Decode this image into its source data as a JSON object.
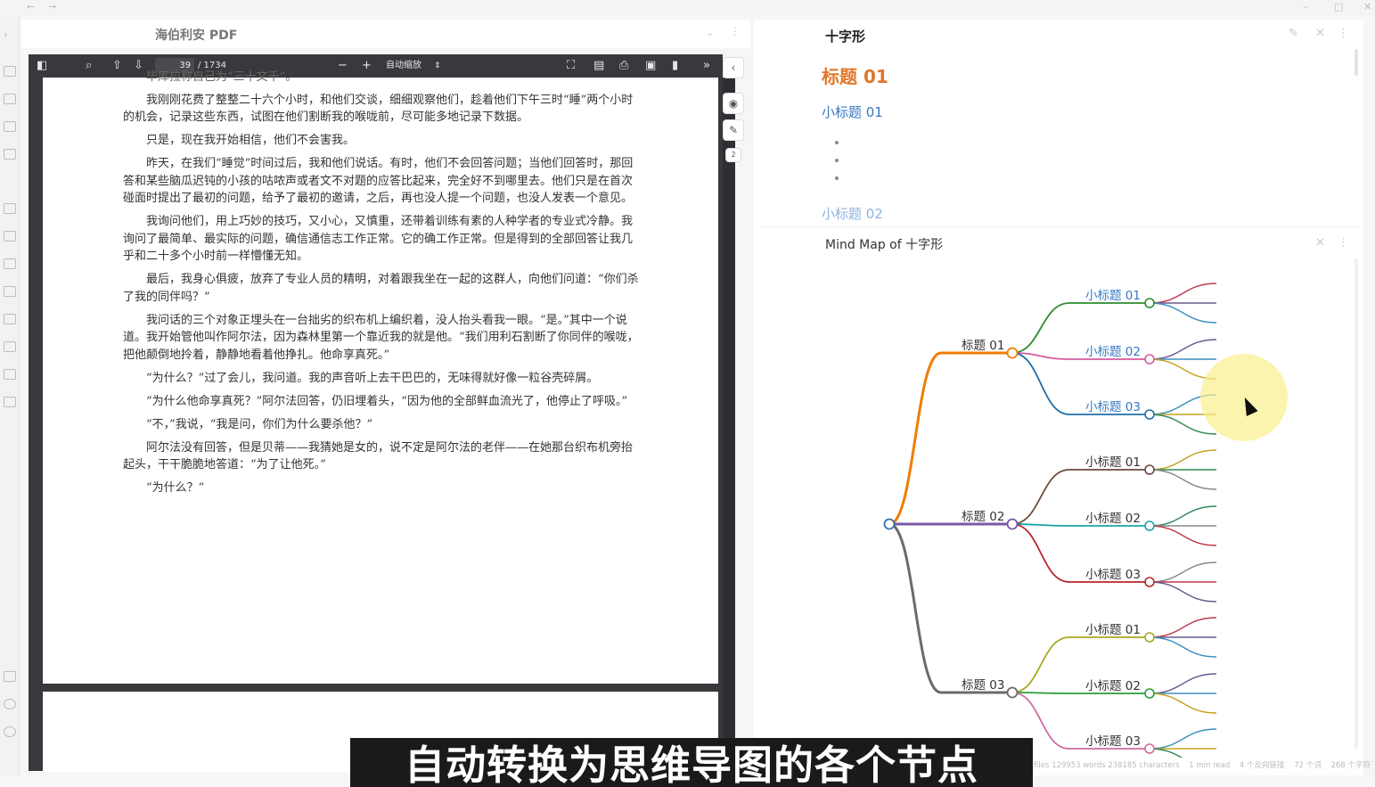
{
  "window": {
    "back": "←",
    "forward": "→",
    "minimize": "–",
    "maximize": "□",
    "close": "✕"
  },
  "pdf": {
    "tab_title": "海伯利安 PDF",
    "page_current": "39",
    "page_total": "/ 1734",
    "zoom_label": "自动缩放",
    "zoom_minus": "−",
    "zoom_plus": "+",
    "more": "»",
    "paragraphs": [
      "我刚刚花费了整整二十六个小时，和他们交谈，细细观察他们，趁着他们下午三时“睡”两个小时的机会，记录这些东西，试图在他们割断我的喉咙前，尽可能多地记录下数据。",
      "只是，现在我开始相信，他们不会害我。",
      "昨天，在我们“睡觉”时间过后，我和他们说话。有时，他们不会回答问题；当他们回答时，那回答和某些脑瓜迟钝的小孩的咕哝声或者文不对题的应答比起来，完全好不到哪里去。他们只是在首次碰面时提出了最初的问题，给予了最初的邀请，之后，再也没人提一个问题，也没人发表一个意见。",
      "我询问他们，用上巧妙的技巧，又小心，又慎重，还带着训练有素的人种学者的专业式冷静。我询问了最简单、最实际的问题，确信通信志工作正常。它的确工作正常。但是得到的全部回答让我几乎和二十多个小时前一样懵懂无知。",
      "最后，我身心俱疲，放弃了专业人员的精明，对着跟我坐在一起的这群人，向他们问道：“你们杀了我的同伴吗？”",
      "我问话的三个对象正埋头在一台拙劣的织布机上编织着，没人抬头看我一眼。“是。”其中一个说道。我开始管他叫作阿尔法，因为森林里第一个靠近我的就是他。“我们用利石割断了你同伴的喉咙，把他颠倒地拎着，静静地看着他挣扎。他命享真死。”",
      "“为什么？”过了会儿，我问道。我的声音听上去干巴巴的，无味得就好像一粒谷壳碎屑。",
      "“为什么他命享真死？”阿尔法回答，仍旧埋着头，“因为他的全部鲜血流光了，他停止了呼吸。”",
      "“不，”我说，“我是问，你们为什么要杀他？”",
      "阿尔法没有回答，但是贝蒂——我猜她是女的，说不定是阿尔法的老伴——在她那台织布机旁抬起头，干干脆脆地答道：“为了让他死。”",
      "“为什么？”"
    ],
    "top_partial": "毕库拉称自己为“三十文千”。"
  },
  "note": {
    "title": "十字形",
    "h1": "标题 01",
    "h2a": "小标题 01",
    "h2b": "小标题 02"
  },
  "mindmap": {
    "title": "Mind Map of 十字形",
    "branches": [
      {
        "label": "标题 01",
        "children": [
          "小标题 01",
          "小标题 02",
          "小标题 03"
        ]
      },
      {
        "label": "标题 02",
        "children": [
          "小标题 01",
          "小标题 02",
          "小标题 03"
        ]
      },
      {
        "label": "标题 03",
        "children": [
          "小标题 01",
          "小标题 02",
          "小标题 03"
        ]
      }
    ]
  },
  "status": [
    "files 129953 words 238185 characters",
    "1 min read",
    "4 个反向链接",
    "72 个词",
    "268 个字符"
  ],
  "subtitle": "自动转换为思维导图的各个节点",
  "side_badge": "2",
  "colors": {
    "h1": "#e0762a",
    "h2": "#3778c4",
    "branch1": "#f07d00",
    "branch2": "#7b57a8",
    "branch3": "#6b6b6b"
  }
}
